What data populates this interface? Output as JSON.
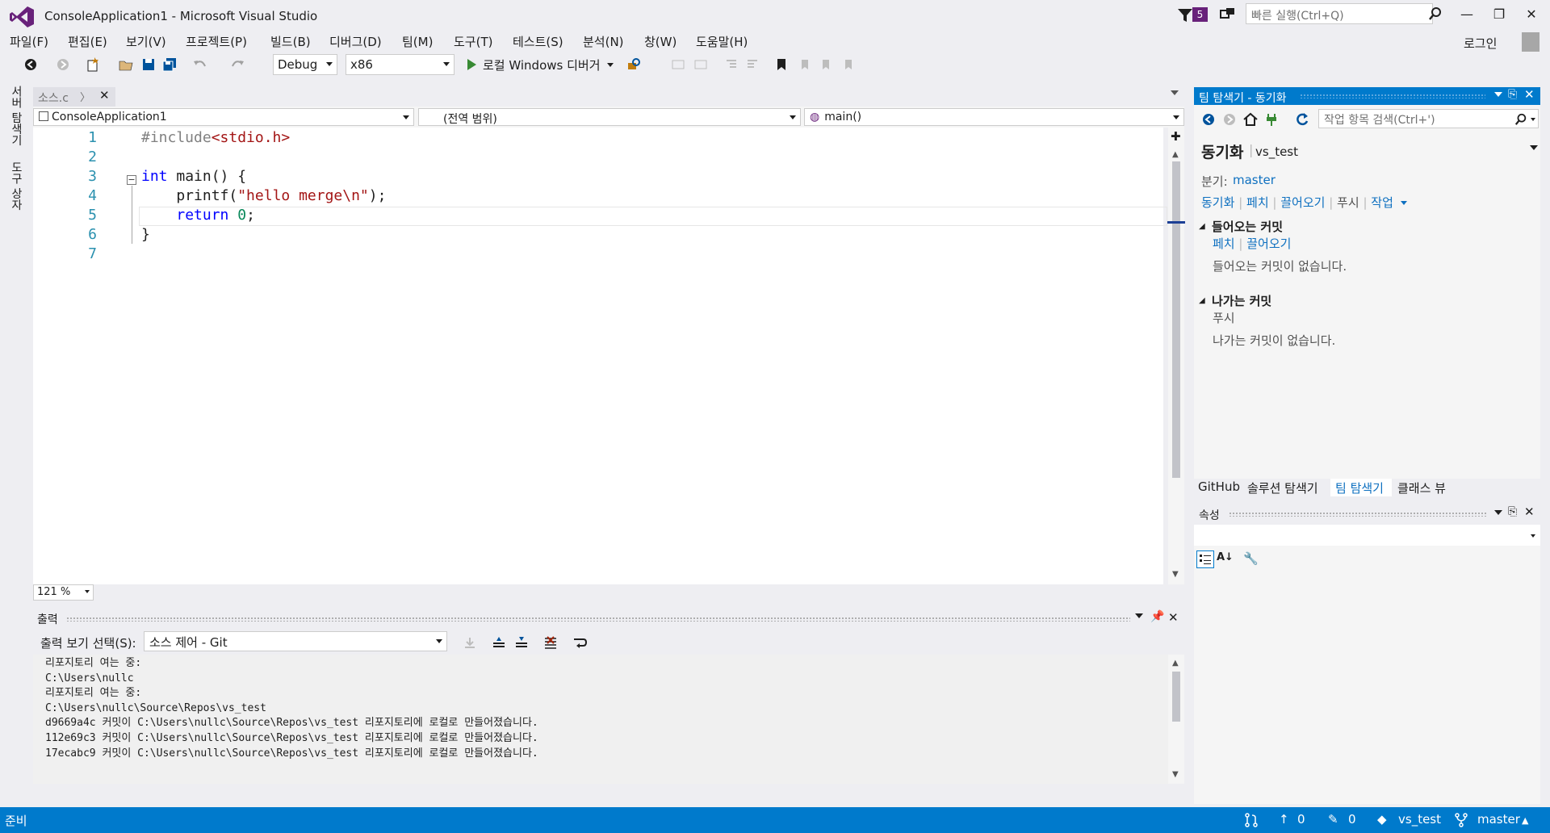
{
  "window": {
    "title": "ConsoleApplication1 - Microsoft Visual Studio",
    "notification_count": "5",
    "quick_launch_placeholder": "빠른 실행(Ctrl+Q)",
    "login_label": "로그인"
  },
  "menu": [
    "파일(F)",
    "편집(E)",
    "보기(V)",
    "프로젝트(P)",
    "빌드(B)",
    "디버그(D)",
    "팀(M)",
    "도구(T)",
    "테스트(S)",
    "분석(N)",
    "창(W)",
    "도움말(H)"
  ],
  "toolbar": {
    "config": "Debug",
    "platform": "x86",
    "debug_target": "로컬 Windows 디버거"
  },
  "left_tabs": [
    "서버 탐색기",
    "도구 상자"
  ],
  "editor": {
    "tab_label": "소스.c",
    "nav_project": "ConsoleApplication1",
    "nav_scope": "(전역 범위)",
    "nav_member": "main()",
    "zoom": "121 %",
    "lines": [
      {
        "num": "1",
        "code": "#include<stdio.h>"
      },
      {
        "num": "2",
        "code": ""
      },
      {
        "num": "3",
        "code": "int main() {"
      },
      {
        "num": "4",
        "code": "    printf(\"hello merge\\n\");"
      },
      {
        "num": "5",
        "code": "    return 0;"
      },
      {
        "num": "6",
        "code": "}"
      },
      {
        "num": "7",
        "code": ""
      }
    ],
    "syntax_colors": {
      "keyword": "#0000ff",
      "string": "#a31515",
      "preprocessor": "#808080",
      "number": "#09885a"
    }
  },
  "output": {
    "title": "출력",
    "show_from_label": "출력 보기 선택(S):",
    "source": "소스 제어 - Git",
    "lines": [
      "리포지토리 여는 중:",
      "C:\\Users\\nullc",
      "리포지토리 여는 중:",
      "C:\\Users\\nullc\\Source\\Repos\\vs_test",
      "d9669a4c 커밋이 C:\\Users\\nullc\\Source\\Repos\\vs_test 리포지토리에 로컬로 만들어졌습니다.",
      "112e69c3 커밋이 C:\\Users\\nullc\\Source\\Repos\\vs_test 리포지토리에 로컬로 만들어졌습니다.",
      "17ecabc9 커밋이 C:\\Users\\nullc\\Source\\Repos\\vs_test 리포지토리에 로컬로 만들어졌습니다."
    ]
  },
  "team_explorer": {
    "header": "팀 탐색기 - 동기화",
    "search_placeholder": "작업 항목 검색(Ctrl+')",
    "page_title": "동기화",
    "repo": "vs_test",
    "branch_label": "분기:",
    "branch": "master",
    "actions": [
      "동기화",
      "페치",
      "끌어오기",
      "푸시",
      "작업"
    ],
    "incoming": {
      "title": "들어오는 커밋",
      "links": [
        "페치",
        "끌어오기"
      ],
      "empty": "들어오는 커밋이 없습니다."
    },
    "outgoing": {
      "title": "나가는 커밋",
      "link": "푸시",
      "empty": "나가는 커밋이 없습니다."
    },
    "tabs": [
      "GitHub",
      "솔루션 탐색기",
      "팀 탐색기",
      "클래스 뷰"
    ]
  },
  "properties": {
    "title": "속성"
  },
  "status": {
    "ready": "준비",
    "push_count": "0",
    "pending_changes": "0",
    "repo": "vs_test",
    "branch": "master"
  },
  "colors": {
    "accent": "#007acc",
    "vs_purple": "#68217a",
    "link": "#0e70c0"
  }
}
